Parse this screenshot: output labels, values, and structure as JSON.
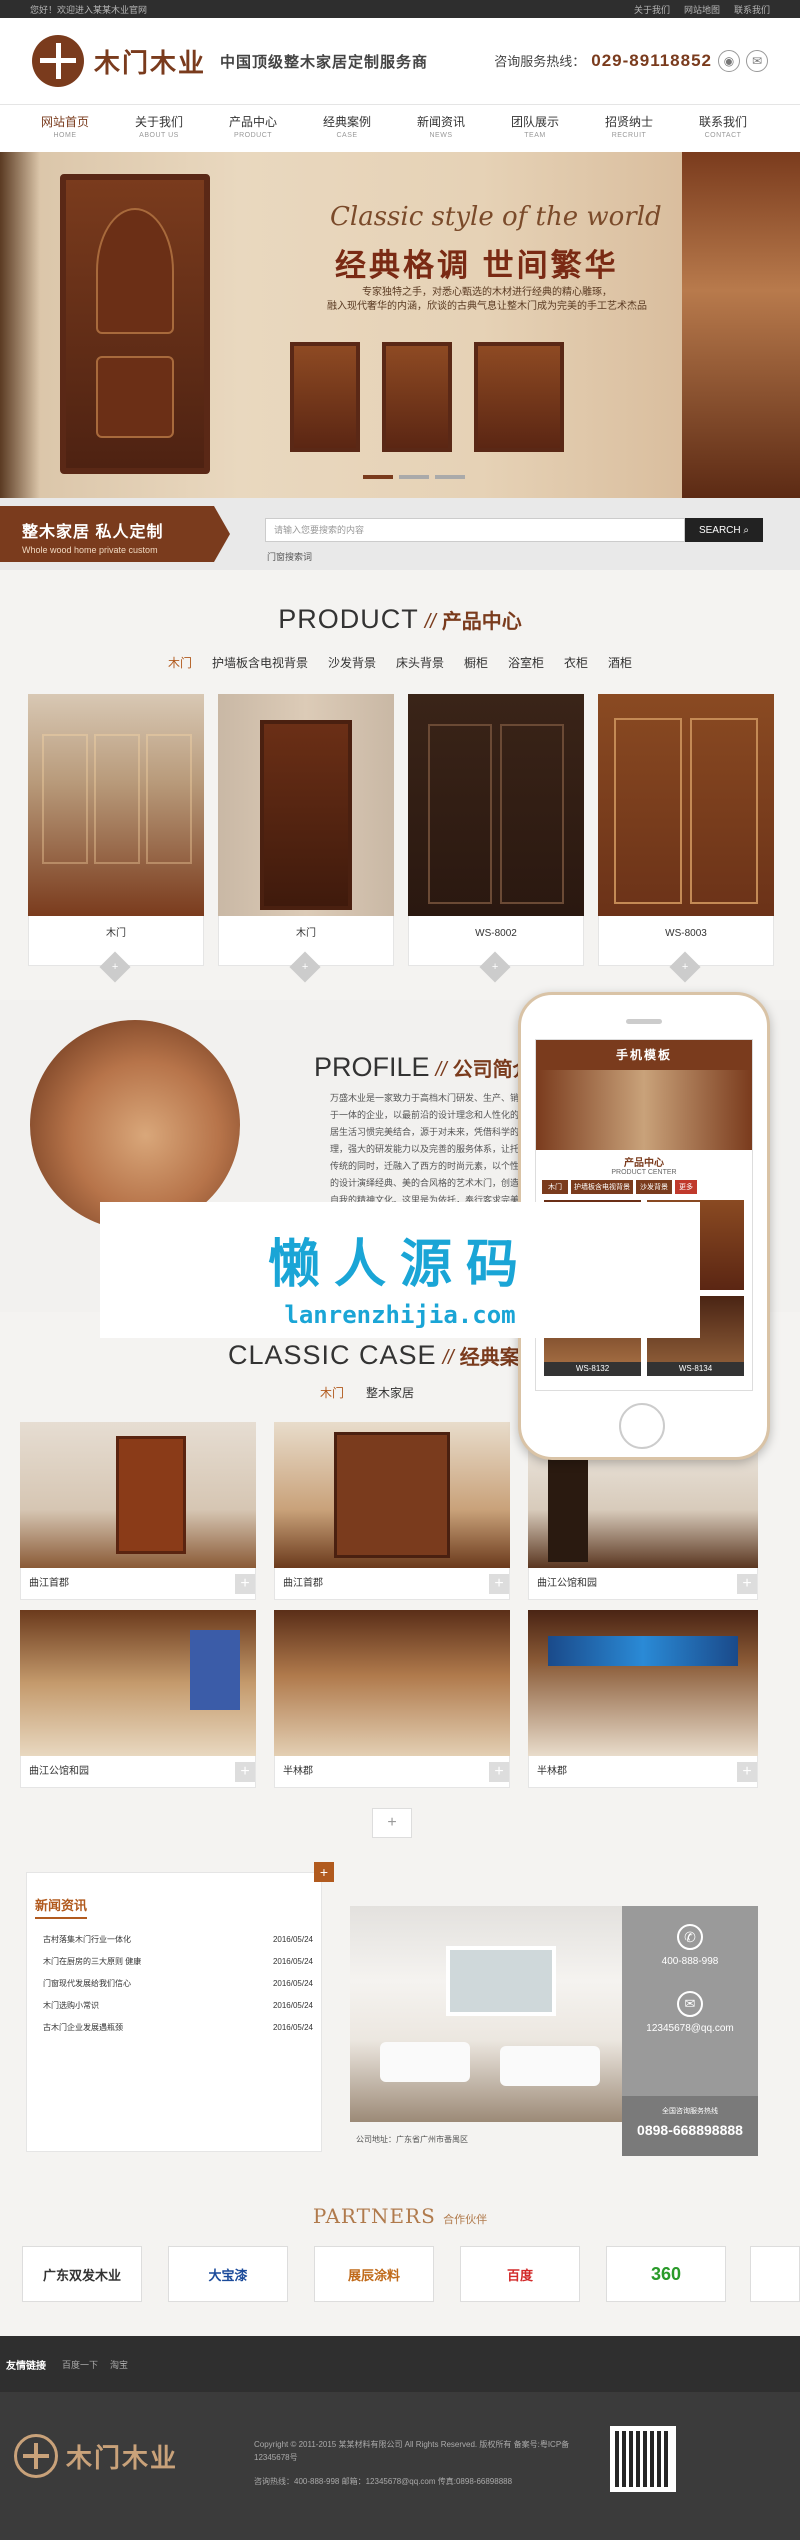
{
  "topbar": {
    "welcome": "您好！欢迎进入某某木业官网",
    "links": [
      "关于我们",
      "网站地图",
      "联系我们"
    ]
  },
  "header": {
    "logo_text": "木门木业",
    "slogan": "中国顶级整木家居定制服务商",
    "hotline_label": "咨询服务热线：",
    "hotline_number": "029-89118852"
  },
  "nav": [
    {
      "cn": "网站首页",
      "en": "HOME"
    },
    {
      "cn": "关于我们",
      "en": "ABOUT US"
    },
    {
      "cn": "产品中心",
      "en": "PRODUCT"
    },
    {
      "cn": "经典案例",
      "en": "CASE"
    },
    {
      "cn": "新闻资讯",
      "en": "NEWS"
    },
    {
      "cn": "团队展示",
      "en": "TEAM"
    },
    {
      "cn": "招贤纳士",
      "en": "RECRUIT"
    },
    {
      "cn": "联系我们",
      "en": "CONTACT"
    }
  ],
  "banner": {
    "en_title": "Classic style of the world",
    "cn_title": "经典格调 世间繁华",
    "desc_line1": "专家独特之手，对悉心甄选的木材进行经典的精心雕琢，",
    "desc_line2": "融入现代奢华的内涵，欣谈的古典气息让整木门成为完美的手工艺术杰品"
  },
  "search_strip": {
    "tag_title": "整木家居 私人定制",
    "tag_sub": "Whole wood home private custom",
    "placeholder": "请输入您要搜索的内容",
    "button": "SEARCH",
    "hot_words": "门窗搜索词"
  },
  "product": {
    "title_en": "PRODUCT",
    "slash": "//",
    "title_cn": "产品中心",
    "tabs": [
      "木门",
      "护墙板含电视背景",
      "沙发背景",
      "床头背景",
      "橱柜",
      "浴室柜",
      "衣柜",
      "酒柜"
    ],
    "items": [
      {
        "name": "木门"
      },
      {
        "name": "木门"
      },
      {
        "name": "WS-8002"
      },
      {
        "name": "WS-8003"
      }
    ]
  },
  "profile": {
    "title_en": "PROFILE",
    "slash": "//",
    "title_cn": "公司简介",
    "text": "万盛木业是一家致力于高档木门研发、生产、销售于一体的企业，以最前沿的设计理念和人性化的家居生活习惯完美结合，源于对未来，凭借科学的管理，强大的研发能力以及完善的服务体系，让托于传统的同时，迁融入了西方的时尚元素，以个性化的设计演绎经典、美的合风格的艺术木门，创造着自我的精神文化。这里是为依托，奉行客求完美、事献卓越的品牌主张。"
  },
  "phone": {
    "header": "手机模板",
    "section_cn": "产品中心",
    "section_en": "PRODUCT CENTER",
    "tabs": [
      "木门",
      "护墙板含电视背景",
      "沙发背景",
      "更多"
    ],
    "items": [
      "WS-8132",
      "WS-8134"
    ]
  },
  "watermark": {
    "cn": "懒人源码",
    "en": "lanrenzhijia.com"
  },
  "case": {
    "title_en": "CLASSIC CASE",
    "slash": "//",
    "title_cn": "经典案例",
    "tabs": [
      "木门",
      "整木家居"
    ],
    "items": [
      {
        "name": "曲江首郡"
      },
      {
        "name": "曲江首郡"
      },
      {
        "name": "曲江公馆和园"
      },
      {
        "name": "曲江公馆和园"
      },
      {
        "name": "半林郡"
      },
      {
        "name": "半林郡"
      }
    ],
    "more": "+"
  },
  "news": {
    "title": "新闻资讯",
    "more": "+",
    "items": [
      {
        "title": "古村落集木门行业一体化",
        "date": "2016/05/24"
      },
      {
        "title": "木门在厨房的三大原则 健康",
        "date": "2016/05/24"
      },
      {
        "title": "门窗现代发展给我们信心",
        "date": "2016/05/24"
      },
      {
        "title": "木门选购小常识",
        "date": "2016/05/24"
      },
      {
        "title": "古木门企业发展遇瓶颈",
        "date": "2016/05/24"
      }
    ],
    "address": "公司地址：广东省广州市番禺区"
  },
  "contact": {
    "phone": "400-888-998",
    "email": "12345678@qq.com",
    "hotline_label": "全国咨询服务热线",
    "hotline": "0898-668898888"
  },
  "partners": {
    "title_en": "PARTNERS",
    "title_cn": "合作伙伴",
    "items": [
      "广东双发木业",
      "大宝漆",
      "展辰涂料",
      "百度",
      "360"
    ]
  },
  "friend_links": {
    "label": "友情链接",
    "items": [
      "百度一下",
      "淘宝"
    ]
  },
  "footer": {
    "logo_text": "木门木业",
    "copyright": "Copyright © 2011-2015 某某材料有限公司 All Rights Reserved. 版权所有    备案号:粤ICP备12345678号",
    "contact": "咨询热线：400-888-998      邮箱：12345678@qq.com      传真:0898-66898888"
  }
}
